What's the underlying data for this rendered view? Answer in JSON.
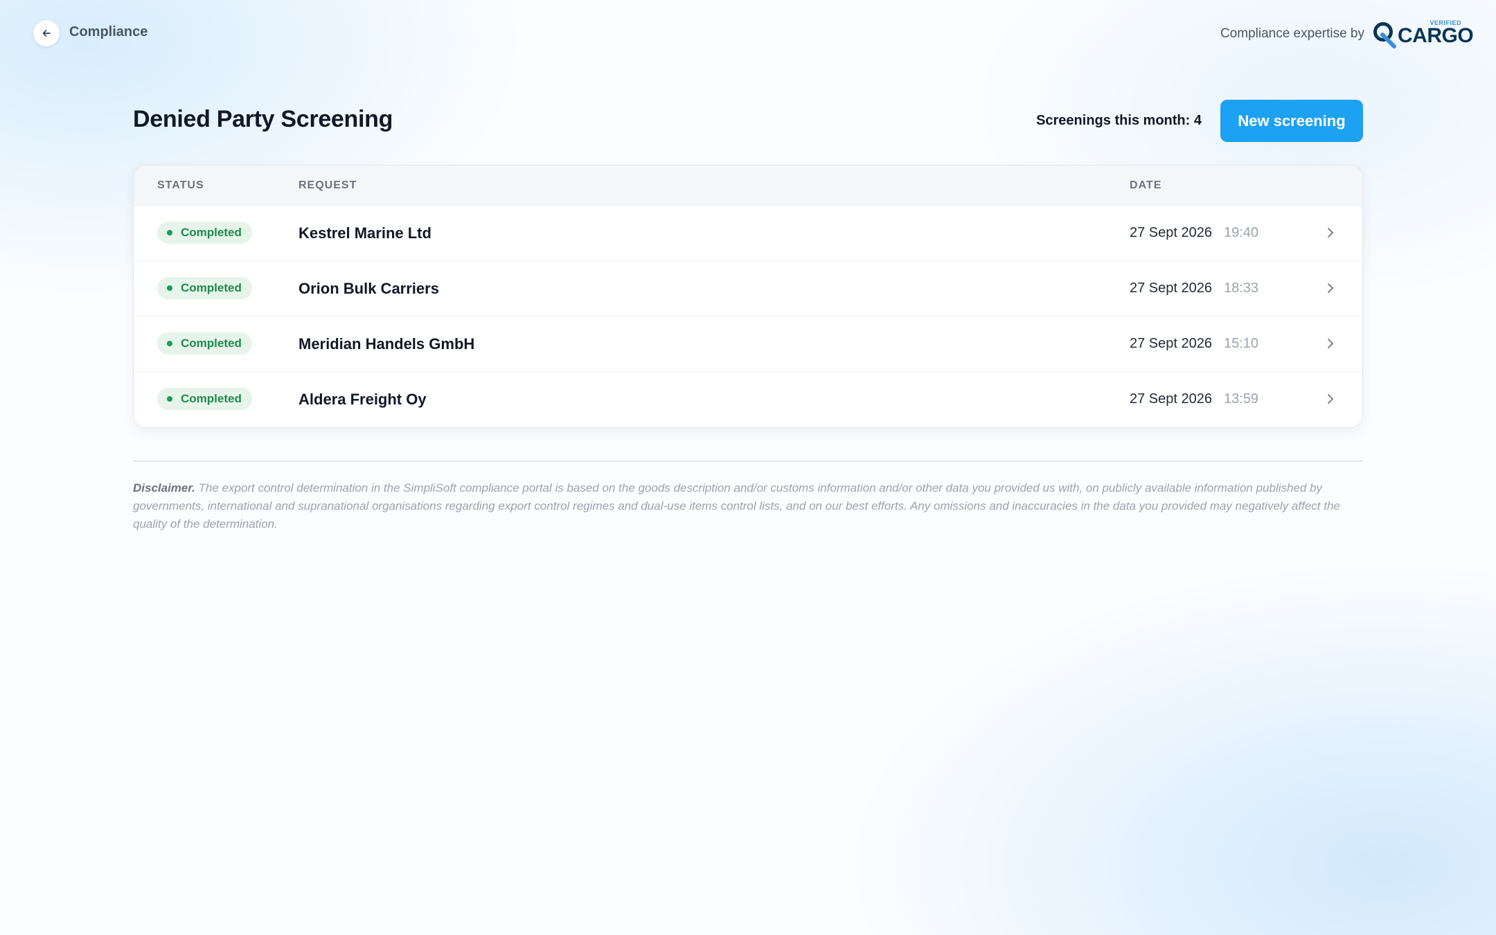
{
  "topbar": {
    "breadcrumb": "Compliance",
    "brand_prefix": "Compliance expertise by",
    "brand_badge": "VERIFIED",
    "brand_name": "CARGO"
  },
  "header": {
    "title": "Denied Party Screening",
    "counter_label": "Screenings this month: 4",
    "new_button": "New screening"
  },
  "table": {
    "columns": {
      "status": "STATUS",
      "request": "REQUEST",
      "date": "DATE"
    },
    "rows": [
      {
        "status": "Completed",
        "request": "Kestrel Marine Ltd",
        "date": "27 Sept 2026",
        "time": "19:40"
      },
      {
        "status": "Completed",
        "request": "Orion Bulk Carriers",
        "date": "27 Sept 2026",
        "time": "18:33"
      },
      {
        "status": "Completed",
        "request": "Meridian Handels GmbH",
        "date": "27 Sept 2026",
        "time": "15:10"
      },
      {
        "status": "Completed",
        "request": "Aldera Freight Oy",
        "date": "27 Sept 2026",
        "time": "13:59"
      }
    ]
  },
  "disclaimer": {
    "label": "Disclaimer.",
    "text": "The export control determination in the SimpliSoft compliance portal is based on the goods description and/or customs information and/or other data you provided us with, on publicly available information published by governments, international and supranational organisations regarding export control regimes and dual-use items control lists, and on our best efforts. Any omissions and inaccuracies in the data you provided may negatively affect the quality of the determination."
  },
  "colors": {
    "accent": "#1da1f2",
    "status_completed_bg": "#e6f4ea",
    "status_completed_text": "#1f8a4c",
    "brand": "#0b3556"
  },
  "icons": {
    "back": "arrow-left-icon",
    "row_action": "chevron-right-icon",
    "status": "dot-icon"
  }
}
